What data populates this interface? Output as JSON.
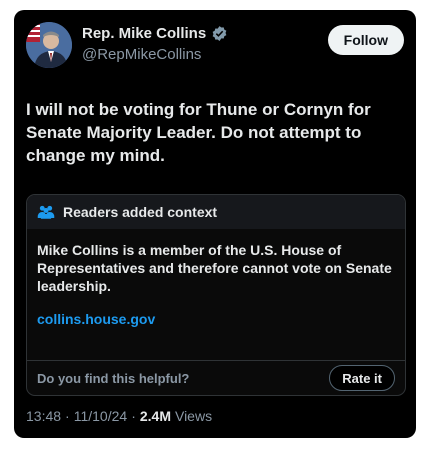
{
  "author": {
    "display_name": "Rep. Mike Collins",
    "handle": "@RepMikeCollins"
  },
  "follow_label": "Follow",
  "tweet": {
    "text": "I will not be voting for Thune or Cornyn for Senate Majority Leader. Do not attempt to change my mind."
  },
  "community_note": {
    "header": "Readers added context",
    "body": "Mike Collins is a member of the U.S. House of Representatives and therefore cannot vote on Senate leadership.",
    "link": "collins.house.gov",
    "helpful_prompt": "Do you find this helpful?",
    "rate_label": "Rate it"
  },
  "meta": {
    "time": "13:48",
    "sep": "·",
    "date": "11/10/24",
    "views_count": "2.4M",
    "views_label": "Views"
  },
  "colors": {
    "background": "#000000",
    "text_primary": "#e7e9ea",
    "text_secondary": "#8b98a5",
    "link": "#1d9bf0",
    "verified": "#829aab"
  },
  "icons": [
    "avatar-photo",
    "verified-badge-icon",
    "people-icon"
  ]
}
